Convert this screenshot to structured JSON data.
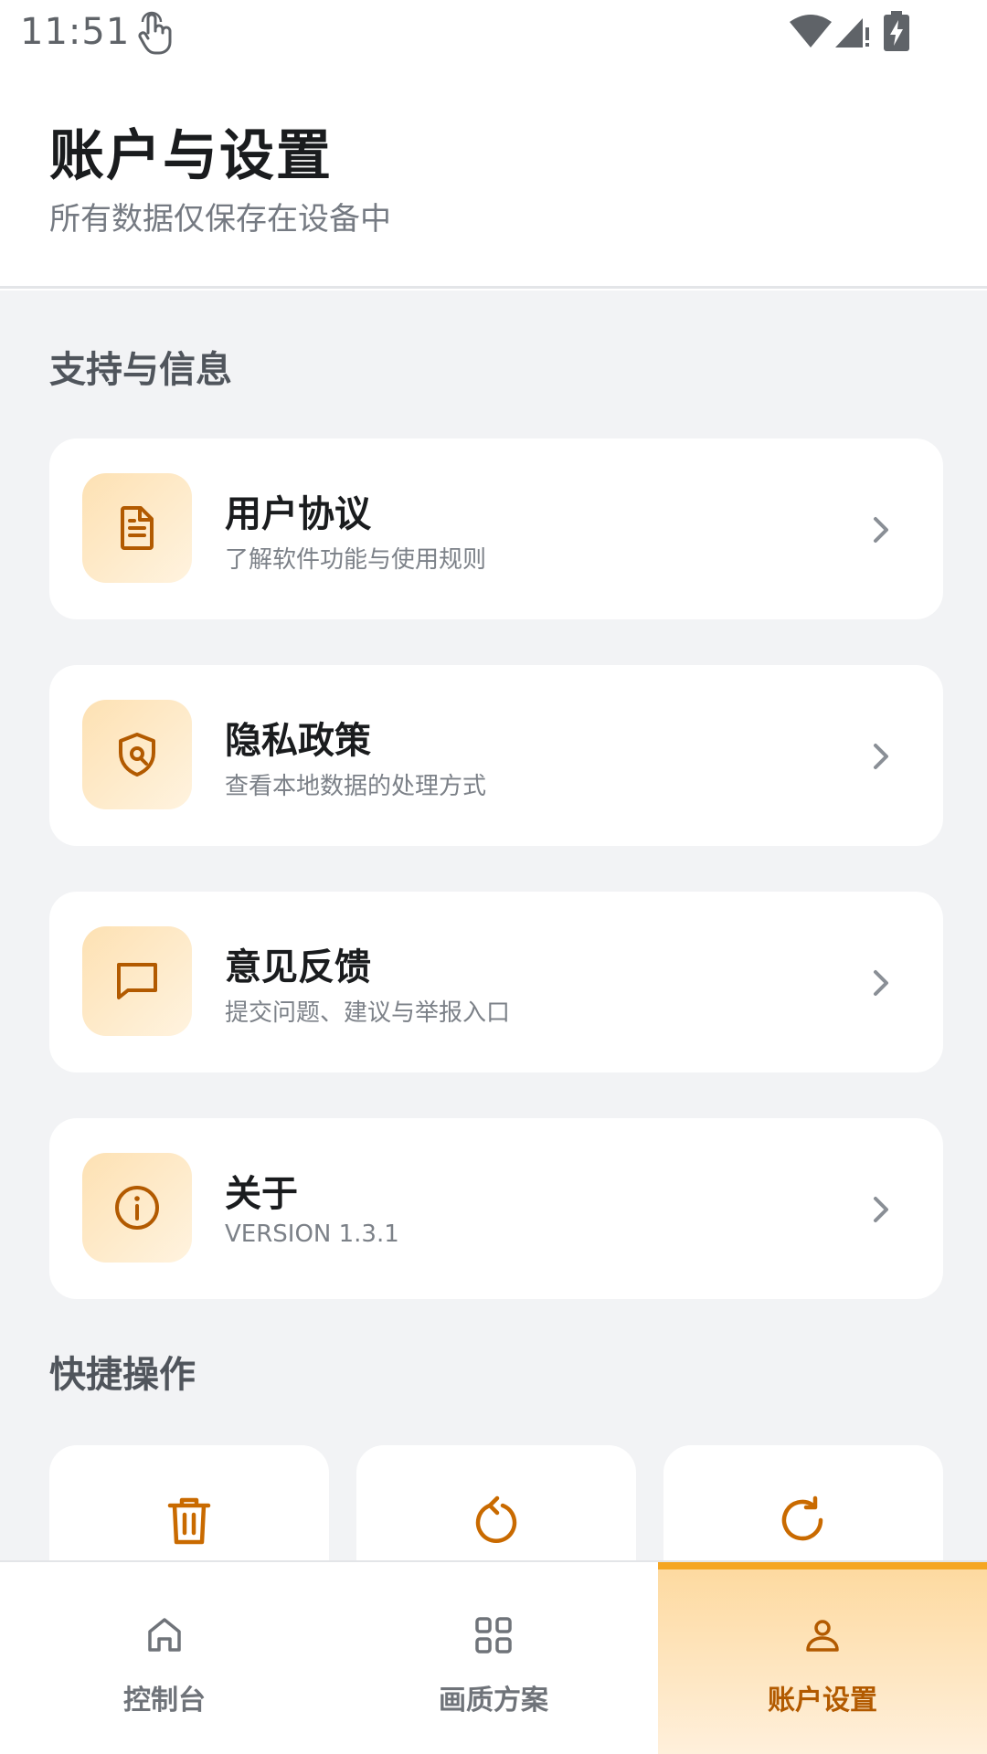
{
  "status_bar": {
    "time": "11:51"
  },
  "header": {
    "title": "账户与设置",
    "subtitle": "所有数据仅保存在设备中"
  },
  "sections": {
    "support": {
      "title": "支持与信息",
      "items": [
        {
          "title": "用户协议",
          "desc": "了解软件功能与使用规则",
          "icon": "document-icon"
        },
        {
          "title": "隐私政策",
          "desc": "查看本地数据的处理方式",
          "icon": "shield-icon"
        },
        {
          "title": "意见反馈",
          "desc": "提交问题、建议与举报入口",
          "icon": "message-icon"
        },
        {
          "title": "关于",
          "desc": "VERSION 1.3.1",
          "icon": "info-icon"
        }
      ]
    },
    "quick": {
      "title": "快捷操作",
      "items": [
        {
          "icon": "trash-icon"
        },
        {
          "icon": "rotate-icon"
        },
        {
          "icon": "refresh-icon"
        }
      ]
    }
  },
  "nav": {
    "items": [
      {
        "label": "控制台",
        "icon": "home-icon"
      },
      {
        "label": "画质方案",
        "icon": "grid-icon"
      },
      {
        "label": "账户设置",
        "icon": "user-icon",
        "active": true
      }
    ]
  },
  "colors": {
    "accent": "#b25a00",
    "accent_bar": "#f5a623",
    "icon_bg_start": "#fde1b3",
    "icon_bg_end": "#fff3df",
    "page_bg": "#f2f3f5"
  }
}
